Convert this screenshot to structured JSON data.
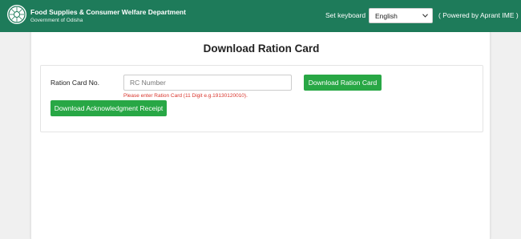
{
  "header": {
    "title": "Food Supplies & Consumer Welfare Department",
    "subtitle": "Government of Odisha",
    "keyboard_label": "Set keyboard",
    "language_selected": "English",
    "powered_by": "( Powered by Aprant IME )",
    "bg_color": "#1e7b5a"
  },
  "main": {
    "title": "Download Ration Card",
    "ration_card_label": "Ration Card No.",
    "ration_card_placeholder": "RC Number",
    "ration_card_value": "",
    "download_button": "Download Ration Card",
    "hint": "Please enter Ration Card (11 Digit e.g.19130120010).",
    "ack_button": "Download Acknowledgment Receipt",
    "button_color": "#28a745",
    "hint_color": "#d9342b"
  },
  "icons": {
    "logo": "odisha-emblem-icon",
    "dropdown": "chevron-down-icon"
  }
}
